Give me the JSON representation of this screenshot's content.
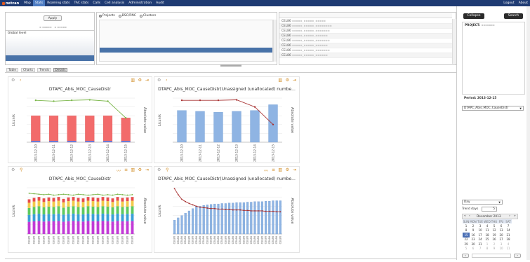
{
  "nav": {
    "logo": "netcan",
    "items": [
      {
        "label": "Map"
      },
      {
        "label": "Stats",
        "active": true
      },
      {
        "label": "Roaming stats"
      },
      {
        "label": "TAC stats"
      },
      {
        "label": "Calls"
      },
      {
        "label": "Cell analysis"
      },
      {
        "label": "Administration"
      },
      {
        "label": "Audit"
      }
    ],
    "logout": "Logout",
    "about": "About"
  },
  "filter": {
    "apply": "Apply",
    "global_level": "Global level",
    "radios": [
      {
        "label": "Projects",
        "checked": true
      },
      {
        "label": "BSC/RNC",
        "checked": false
      },
      {
        "label": "Clusters",
        "checked": false
      }
    ],
    "cells": [
      "CEL86",
      "CEL86",
      "CEL86",
      "CEL86",
      "CEL86",
      "CEL86",
      "CEL86",
      "CEL86"
    ]
  },
  "tabs": [
    {
      "label": "Table"
    },
    {
      "label": "Charts"
    },
    {
      "label": "Trends"
    },
    {
      "label": "Details",
      "active": true
    }
  ],
  "right": {
    "collapse": "Collapse",
    "search": "Search",
    "project_label": "PROJECT:",
    "period": "Period: 2013-12-15",
    "kpi_select": "DTAPC_Abis_MOC_CauseDistr",
    "granularity": "Day",
    "trend_days_label": "Trend days",
    "trend_days": "5",
    "calendar": {
      "month": "December 2013",
      "weekdays": [
        "SUN",
        "MON",
        "TUE",
        "WED",
        "THU",
        "FRI",
        "SAT"
      ],
      "weeks": [
        [
          "1",
          "2",
          "3",
          "4",
          "5",
          "6",
          "7"
        ],
        [
          "8",
          "9",
          "10",
          "11",
          "12",
          "13",
          "14"
        ],
        [
          "15",
          "16",
          "17",
          "18",
          "19",
          "20",
          "21"
        ],
        [
          "22",
          "23",
          "24",
          "25",
          "26",
          "27",
          "28"
        ],
        [
          "29",
          "30",
          "31",
          "1",
          "2",
          "3",
          "4"
        ],
        [
          "5",
          "6",
          "7",
          "8",
          "9",
          "10",
          "11"
        ]
      ],
      "selected": "15"
    }
  },
  "charts": [
    {
      "title": "DTAPC_Abis_MOC_CauseDistr",
      "ylabel": "Licznik",
      "y2label": "Absolute value",
      "categories": [
        "2013-12-10",
        "2013-12-11",
        "2013-12-12",
        "2013-12-13",
        "2013-12-14",
        "2013-12-15"
      ],
      "chart_data": {
        "type": "bar",
        "categories": [
          "2013-12-10",
          "2013-12-11",
          "2013-12-12",
          "2013-12-13",
          "2013-12-14",
          "2013-12-15"
        ],
        "values": [
          0.6,
          0.6,
          0.6,
          0.6,
          0.6,
          0.55
        ],
        "line": [
          0.95,
          0.93,
          0.95,
          0.96,
          0.93,
          0.55
        ],
        "colors": {
          "bar": "#f26b6b",
          "line": "#7ab648"
        }
      }
    },
    {
      "title": "DTAPC_Abis_MOC_CauseDistr(Unassigned (unallocated) numbe...",
      "ylabel": "Licznik",
      "y2label": "Absolute value",
      "categories": [
        "2013-12-10",
        "2013-12-11",
        "2013-12-12",
        "2013-12-13",
        "2013-12-14",
        "2013-12-15"
      ],
      "chart_data": {
        "type": "bar",
        "categories": [
          "2013-12-10",
          "2013-12-11",
          "2013-12-12",
          "2013-12-13",
          "2013-12-14",
          "2013-12-15"
        ],
        "values": [
          0.72,
          0.7,
          0.68,
          0.7,
          0.72,
          0.85
        ],
        "line": [
          0.95,
          0.95,
          0.95,
          0.96,
          0.8,
          0.4
        ],
        "colors": {
          "bar": "#8fb4e3",
          "line": "#a83232"
        }
      }
    },
    {
      "title": "DTAPC_Abis_MOC_CauseDistr",
      "ylabel": "Licznik",
      "y2label": "Absolute value",
      "categories": [
        "CEL86",
        "CEL86",
        "CEL86",
        "CEL86",
        "CEL86",
        "CEL86",
        "CEL86",
        "CEL86",
        "CEL86",
        "CEL86",
        "CEL86",
        "CEL86",
        "CEL86",
        "CEL86",
        "CEL86",
        "CEL86",
        "CEL86",
        "CEL86",
        "CEL86",
        "CEL86",
        "CEL86",
        "CEL86"
      ],
      "chart_data": {
        "type": "bar",
        "stacked_colors": [
          "#c23ad6",
          "#3aa0d6",
          "#5ec95e",
          "#f2c94c",
          "#e84c4c"
        ],
        "values": [
          0.75,
          0.78,
          0.8,
          0.77,
          0.79,
          0.78,
          0.8,
          0.76,
          0.79,
          0.8,
          0.78,
          0.77,
          0.8,
          0.79,
          0.78,
          0.8,
          0.79,
          0.77,
          0.8,
          0.78,
          0.79,
          0.8
        ],
        "line": [
          0.88,
          0.87,
          0.86,
          0.85,
          0.86,
          0.84,
          0.85,
          0.86,
          0.85,
          0.84,
          0.86,
          0.85,
          0.84,
          0.85,
          0.86,
          0.84,
          0.85,
          0.84,
          0.86,
          0.85,
          0.84,
          0.85
        ],
        "colors": {
          "line": "#7ab648"
        }
      }
    },
    {
      "title": "DTAPC_Abis_MOC_CauseDistr(Unassigned (unallocated) numbe...",
      "ylabel": "Licznik",
      "y2label": "Absolute value",
      "categories": [
        "CEL86",
        "CEL86",
        "CEL86",
        "CEL86",
        "CEL86",
        "CEL86",
        "CEL86",
        "CEL86",
        "CEL86",
        "CEL86",
        "CEL86",
        "CEL86",
        "CEL86",
        "CEL86",
        "CEL86",
        "CEL86",
        "CEL86",
        "CEL86",
        "CEL86",
        "CEL86",
        "CEL86",
        "CEL86",
        "CEL86",
        "CEL86",
        "CEL86",
        "CEL86",
        "CEL86",
        "CEL86",
        "CEL86",
        "CEL86"
      ],
      "chart_data": {
        "type": "bar",
        "values": [
          0.3,
          0.35,
          0.4,
          0.45,
          0.5,
          0.55,
          0.6,
          0.6,
          0.62,
          0.63,
          0.64,
          0.65,
          0.65,
          0.66,
          0.66,
          0.67,
          0.67,
          0.68,
          0.68,
          0.68,
          0.69,
          0.69,
          0.7,
          0.7,
          0.7,
          0.71,
          0.71,
          0.72,
          0.72,
          0.72
        ],
        "line": [
          0.98,
          0.85,
          0.75,
          0.7,
          0.66,
          0.63,
          0.6,
          0.58,
          0.57,
          0.56,
          0.55,
          0.55,
          0.54,
          0.54,
          0.53,
          0.53,
          0.52,
          0.52,
          0.52,
          0.51,
          0.51,
          0.5,
          0.5,
          0.5,
          0.5,
          0.49,
          0.49,
          0.49,
          0.48,
          0.48
        ],
        "colors": {
          "bar": "#8fb4e3",
          "line": "#a83232"
        }
      }
    }
  ]
}
